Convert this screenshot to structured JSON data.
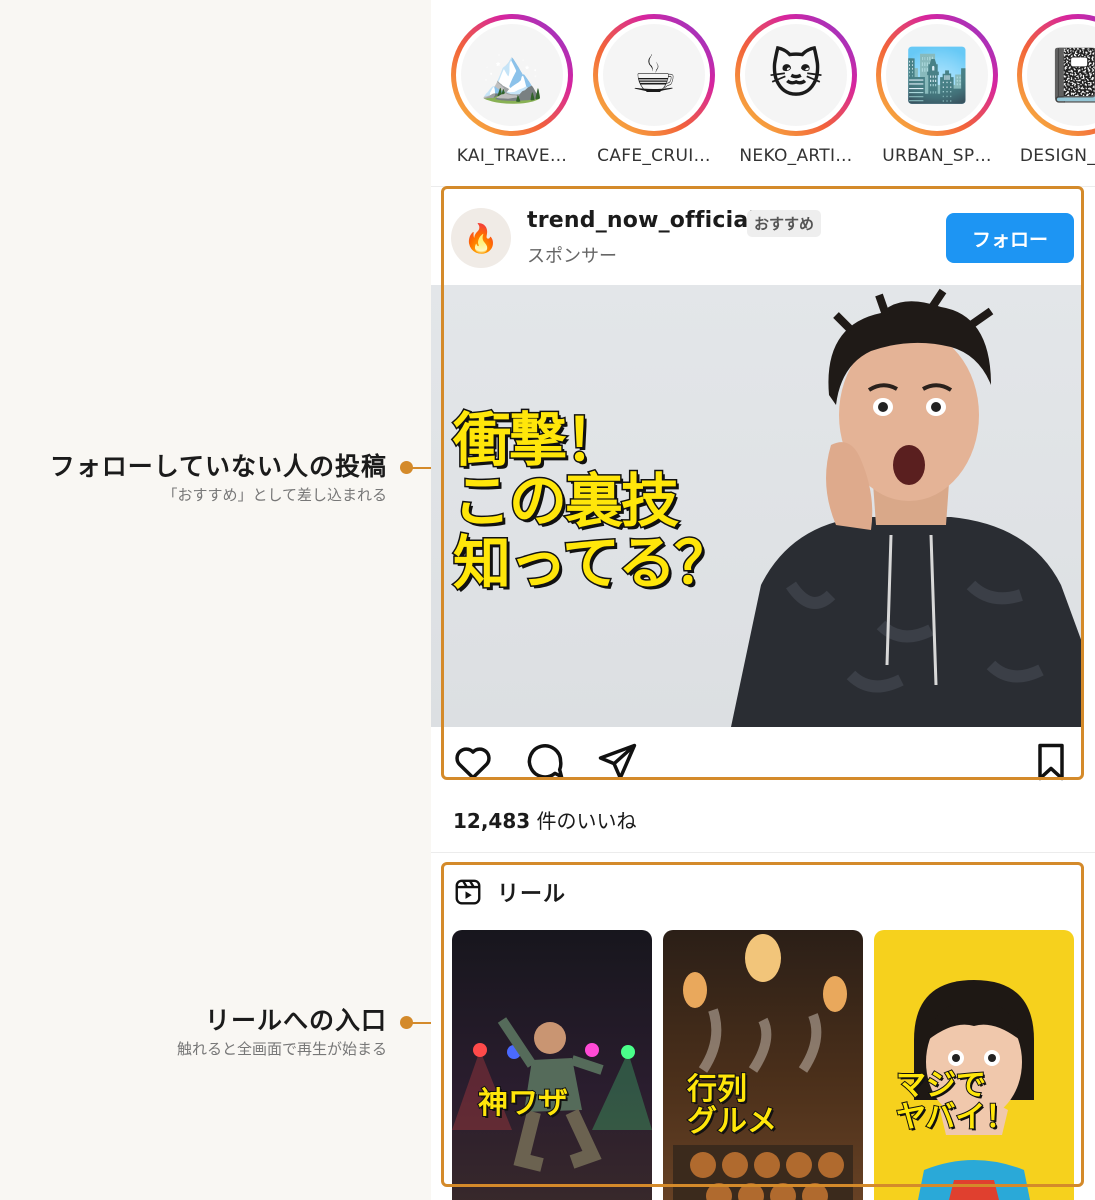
{
  "annotations": [
    {
      "title": "フォローしていない人の投稿",
      "subtitle": "「おすすめ」として差し込まれる"
    },
    {
      "title": "リールへの入口",
      "subtitle": "触れると全画面で再生が始まる"
    }
  ],
  "stories": [
    {
      "name": "KAI_TRAVE…",
      "icon": "mountain-icon",
      "glyph": "🏔️"
    },
    {
      "name": "CAFE_CRUI…",
      "icon": "coffee-icon",
      "glyph": "☕"
    },
    {
      "name": "NEKO_ARTI…",
      "icon": "cat-face-icon",
      "glyph": "🐱"
    },
    {
      "name": "URBAN_SP…",
      "icon": "cityscape-icon",
      "glyph": "🏙️"
    },
    {
      "name": "DESIGN_",
      "icon": "notebook-icon",
      "glyph": "📓"
    }
  ],
  "post": {
    "username": "trend_now_official",
    "badge": "おすすめ",
    "sponsor": "スポンサー",
    "avatar_glyph": "🔥",
    "follow_label": "フォロー",
    "overlay_line1": "衝撃！",
    "overlay_line2": "この裏技",
    "overlay_line3": "知ってる？",
    "likes_count": "12,483",
    "likes_suffix": " 件のいいね"
  },
  "reels": {
    "title": "リール",
    "items": [
      {
        "caption": "神ワザ"
      },
      {
        "caption_l1": "行列",
        "caption_l2": "グルメ"
      },
      {
        "caption_l1": "マジで",
        "caption_l2": "ヤバイ！"
      }
    ]
  },
  "colors": {
    "accent": "#d48a2a",
    "follow_button": "#1d95f3",
    "overlay_text": "#ffe60a"
  }
}
